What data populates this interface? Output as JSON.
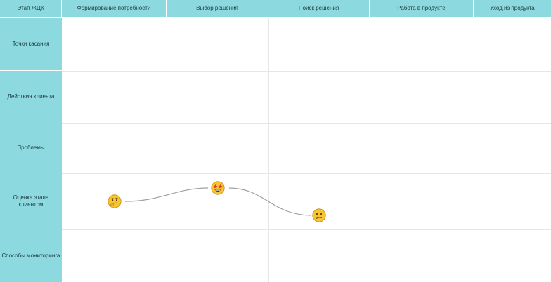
{
  "map": {
    "corner_label": "Этап ЖЦК",
    "stages": [
      "Формирование потребности",
      "Выбор решения",
      "Поиск решения",
      "Работа в продукте",
      "Уход из продукта"
    ],
    "rows": [
      "Точки касания",
      "Действия клиента",
      "Проблемы",
      "Оценка этапа клиентом",
      "Способы мониторинга"
    ],
    "ratings": [
      {
        "stage": "Формирование потребности",
        "icon": "thinking-face-icon"
      },
      {
        "stage": "Выбор решения",
        "icon": "star-struck-face-icon"
      },
      {
        "stage": "Поиск решения",
        "icon": "confused-face-icon"
      }
    ],
    "colors": {
      "header_bg": "#8cdadf",
      "grid": "#e3e7e8",
      "curve": "#a0a0a0",
      "emoji_face": "#f7c531"
    }
  }
}
